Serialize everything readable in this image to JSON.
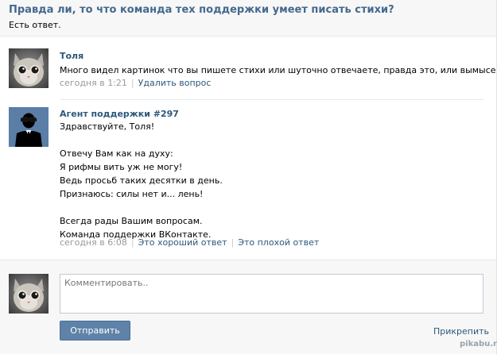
{
  "question": {
    "title": "Правда ли, то что команда тех поддержки умеет писать стихи?",
    "status": "Есть ответ."
  },
  "posts": [
    {
      "author": "Толя",
      "text_lines": [
        "Много видел картинок что вы пишете стихи или шуточно отвечаете, правда это, или вымысел?"
      ],
      "time": "сегодня в 1:21",
      "actions": [
        "Удалить вопрос"
      ],
      "avatar_icon": "cat-avatar-icon"
    },
    {
      "author": "Агент поддержки #297",
      "text_lines": [
        "Здравствуйте, Толя!",
        "",
        "Отвечу Вам как на духу:",
        "Я рифмы вить уж не могу!",
        "Ведь просьб таких десятки в день.",
        "Признаюсь: силы нет и... лень!",
        "",
        "Всегда рады Вашим вопросам.",
        "Команда поддержки ВКонтакте."
      ],
      "time": "сегодня в 6:08",
      "actions": [
        "Это хороший ответ",
        "Это плохой ответ"
      ],
      "avatar_icon": "agent-avatar-icon"
    }
  ],
  "reply": {
    "placeholder": "Комментировать..",
    "value": "",
    "send_label": "Отправить",
    "attach_label": "Прикрепить",
    "avatar_icon": "cat-avatar-icon"
  },
  "watermark": "pikabu.ru",
  "colors": {
    "link": "#2b587a",
    "title": "#45688e",
    "button": "#5e82a8",
    "muted": "#999999",
    "panel_bg": "#f7f7f7"
  }
}
